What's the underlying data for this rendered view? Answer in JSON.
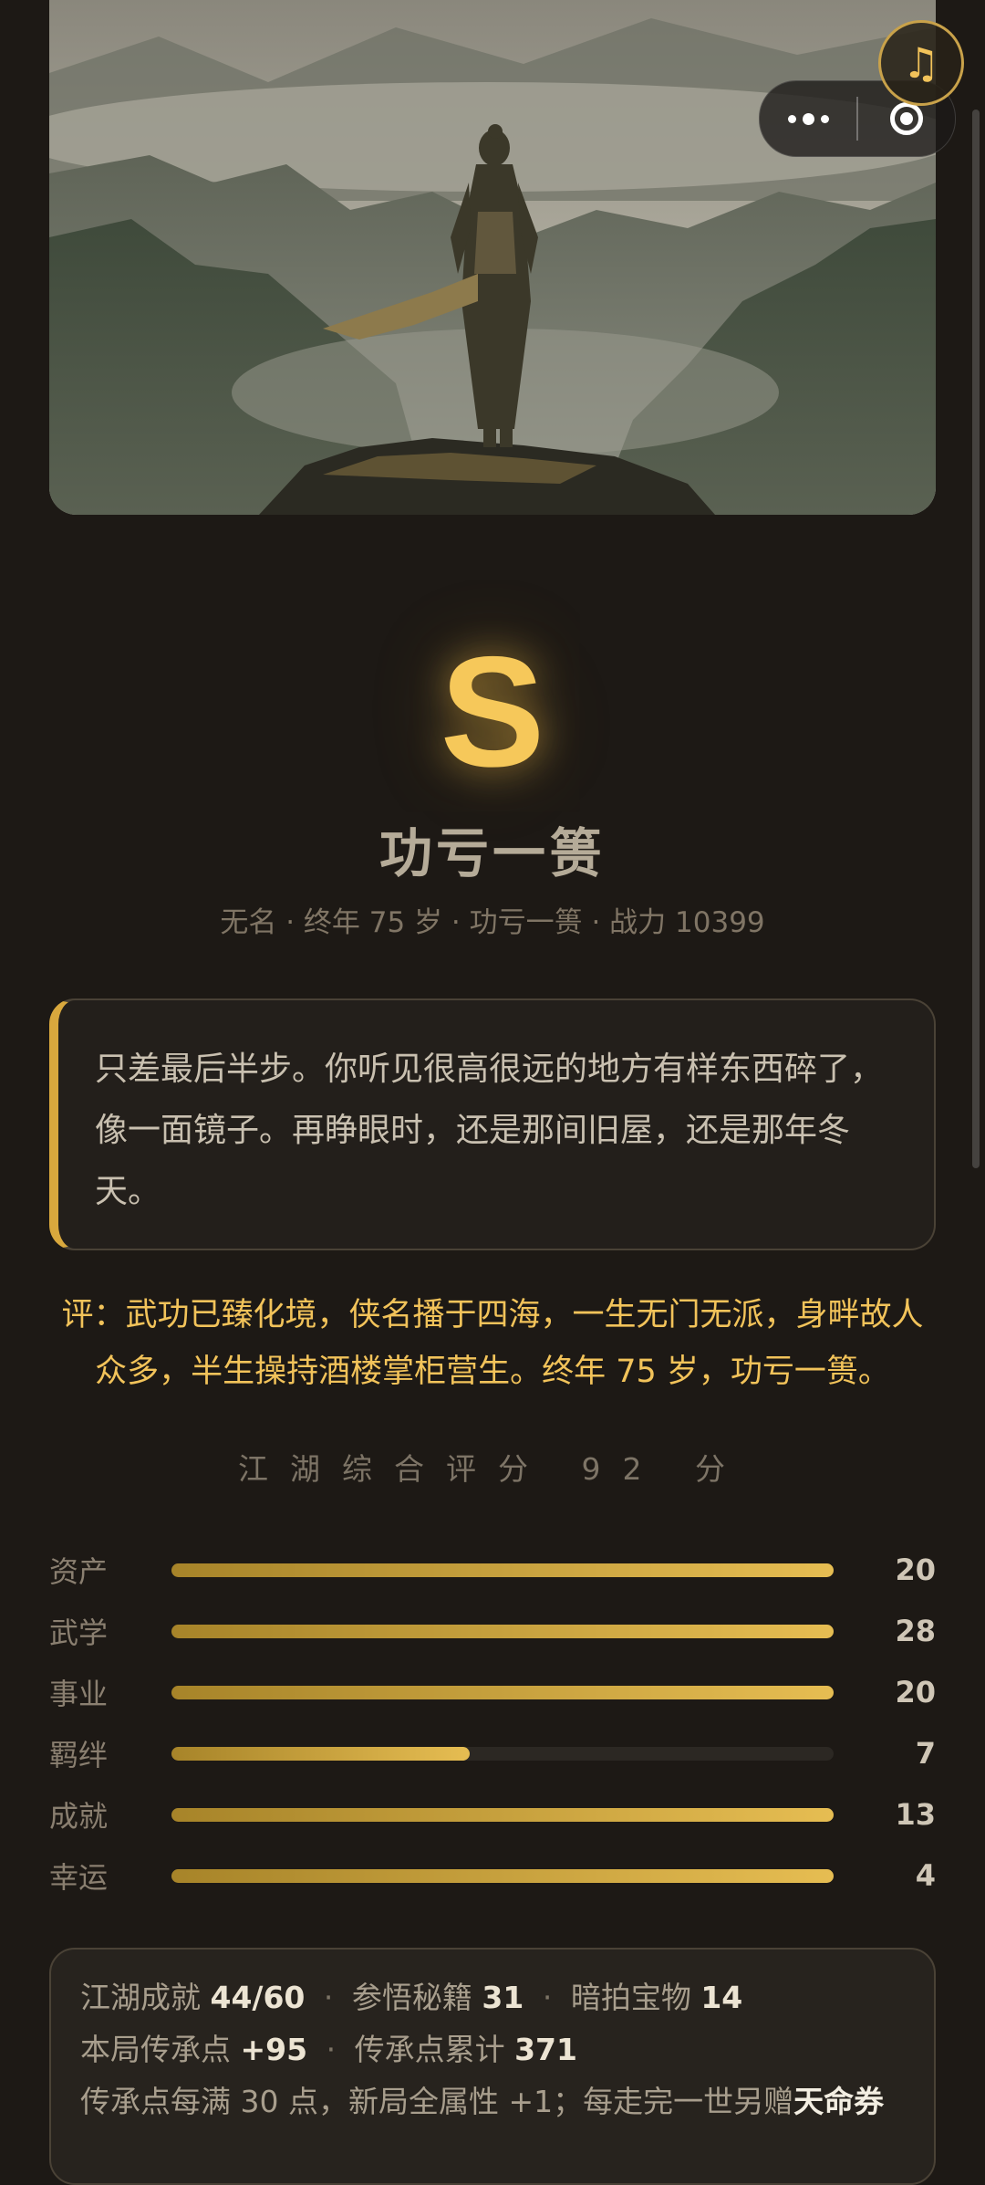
{
  "header": {
    "music_icon": "music-note-icon",
    "more_icon": "more-icon",
    "close_icon": "target-close-icon"
  },
  "result": {
    "grade": "S",
    "title": "功亏一篑",
    "meta": "无名 · 终年 75 岁 · 功亏一篑 · 战力 10399"
  },
  "ending_text": "只差最后半步。你听见很高很远的地方有样东西碎了，像一面镜子。再睁眼时，还是那间旧屋，还是那年冬天。",
  "review": "评：武功已臻化境，侠名播于四海，一生无门无派，身畔故人众多，半生操持酒楼掌柜营生。终年 75 岁，功亏一篑。",
  "score_line": "江湖综合评分 92 分",
  "accent_color": "#f2c35a",
  "chart_data": {
    "type": "bar",
    "orientation": "horizontal",
    "categories": [
      "资产",
      "武学",
      "事业",
      "羁绊",
      "成就",
      "幸运"
    ],
    "values": [
      20,
      28,
      20,
      7,
      13,
      4
    ],
    "fill_fraction": [
      1,
      1,
      1,
      0.45,
      1,
      1
    ]
  },
  "stats": {
    "line1": {
      "achv_label": "江湖成就",
      "achv_value": "44/60",
      "secrets_label": "参悟秘籍",
      "secrets_value": "31",
      "treasure_label": "暗拍宝物",
      "treasure_value": "14"
    },
    "line2": {
      "round_label": "本局传承点",
      "round_value": "+95",
      "total_label": "传承点累计",
      "total_value": "371"
    },
    "line3": {
      "text": "传承点每满 30 点，新局全属性 +1；每走完一世另赠",
      "bold": "天命券"
    }
  }
}
